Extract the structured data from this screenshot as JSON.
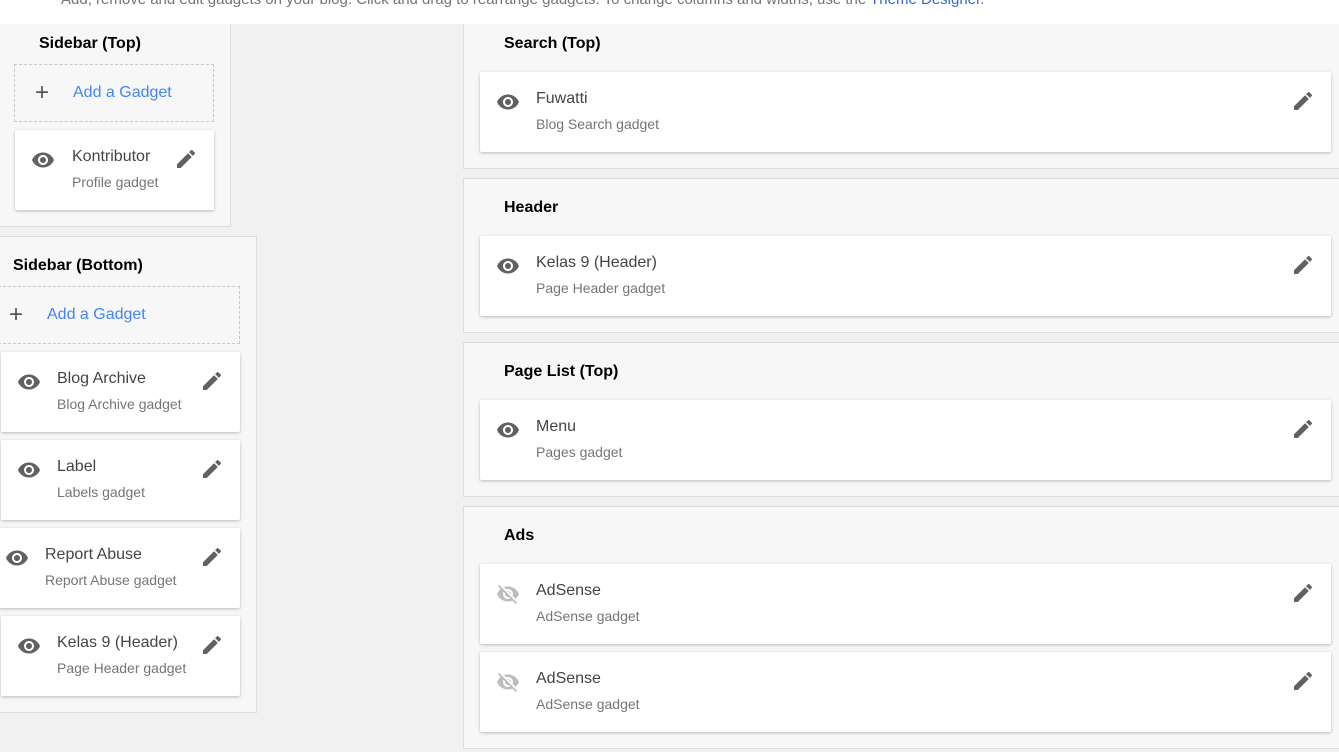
{
  "intro": {
    "text": "Add, remove and edit gadgets on your blog. Click and drag to rearrange gadgets. To change columns and widths, use the ",
    "link": "Theme Designer",
    "suffix": "."
  },
  "add_gadget_label": "Add a Gadget",
  "colors": {
    "accent": "#4285f4",
    "icon": "#616161",
    "hidden_icon": "#bdbdbd"
  },
  "sections": {
    "sidebar_top": {
      "title": "Sidebar (Top)",
      "gadgets": [
        {
          "name": "Kontributor",
          "type": "Profile gadget",
          "visible": true
        }
      ]
    },
    "sidebar_bottom": {
      "title": "Sidebar (Bottom)",
      "gadgets": [
        {
          "name": "Blog Archive",
          "type": "Blog Archive gadget",
          "visible": true
        },
        {
          "name": "Label",
          "type": "Labels gadget",
          "visible": true
        },
        {
          "name": "Report Abuse",
          "type": "Report Abuse gadget",
          "visible": true
        },
        {
          "name": "Kelas 9 (Header)",
          "type": "Page Header gadget",
          "visible": true
        }
      ]
    },
    "search_top": {
      "title": "Search (Top)",
      "gadgets": [
        {
          "name": "Fuwatti",
          "type": "Blog Search gadget",
          "visible": true
        }
      ]
    },
    "header": {
      "title": "Header",
      "gadgets": [
        {
          "name": "Kelas 9 (Header)",
          "type": "Page Header gadget",
          "visible": true
        }
      ]
    },
    "page_list_top": {
      "title": "Page List (Top)",
      "gadgets": [
        {
          "name": "Menu",
          "type": "Pages gadget",
          "visible": true
        }
      ]
    },
    "ads": {
      "title": "Ads",
      "gadgets": [
        {
          "name": "AdSense",
          "type": "AdSense gadget",
          "visible": false
        },
        {
          "name": "AdSense",
          "type": "AdSense gadget",
          "visible": false
        }
      ]
    }
  }
}
